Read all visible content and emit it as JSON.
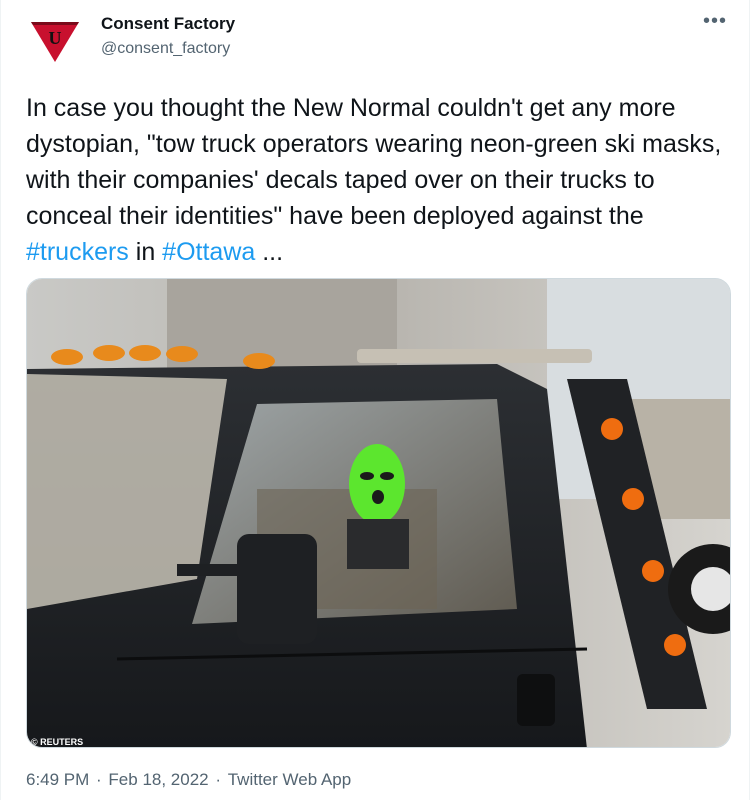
{
  "tweet": {
    "display_name": "Consent Factory",
    "handle": "@consent_factory",
    "more_icon": "more-horizontal-icon",
    "text_parts": {
      "p1": "In case you thought the New Normal couldn't get any more dystopian, \"tow truck operators wearing neon-green ski masks, with their companies' decals taped over on their trucks to conceal their identities\" have been deployed against the ",
      "hashtag1": "#truckers",
      "p2": " in ",
      "hashtag2": "#Ottawa",
      "p3": " ..."
    },
    "media": {
      "credit": "© REUTERS"
    },
    "time": "6:49 PM",
    "sep1": " · ",
    "date": "Feb 18, 2022",
    "sep2": " · ",
    "source": "Twitter Web App"
  },
  "colors": {
    "link": "#1d9bf0",
    "secondary_text": "#536471",
    "avatar_red": "#c8102e",
    "mask_green": "#5ce62e"
  }
}
